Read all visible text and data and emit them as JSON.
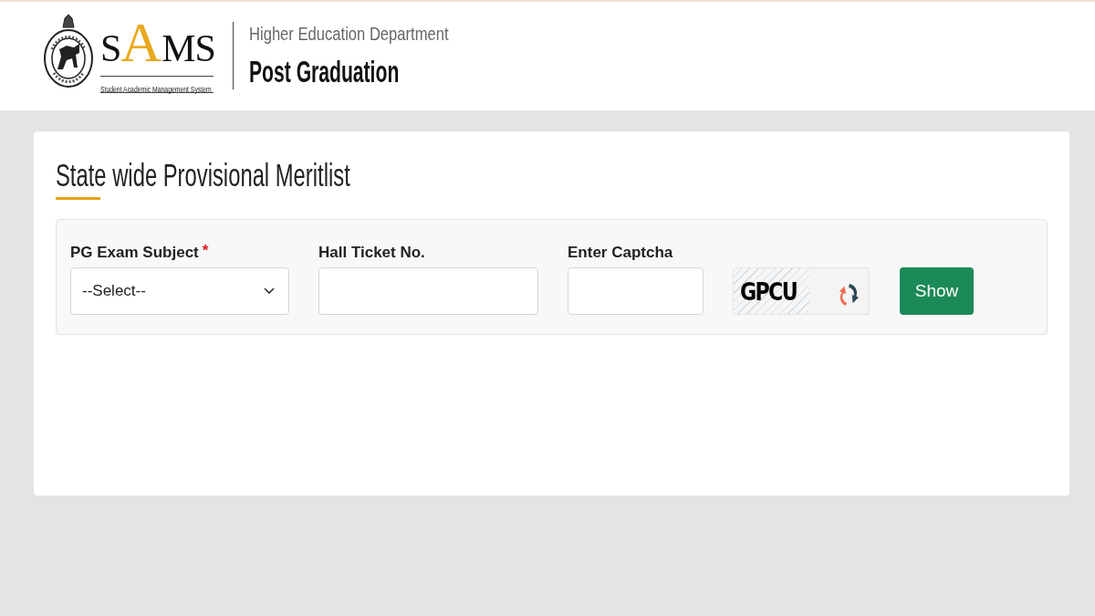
{
  "header": {
    "logo": {
      "wordmark": [
        {
          "text": "S",
          "accent": false
        },
        {
          "text": "A",
          "accent": true
        },
        {
          "text": "MS",
          "accent": false
        }
      ],
      "tagline": "Student Academic Management System"
    },
    "department": "Higher Education Department",
    "portal": "Post Graduation"
  },
  "page": {
    "title": "State wide Provisional Meritlist",
    "form": {
      "required_mark": "*",
      "fields": [
        {
          "kind": "select",
          "label": "PG Exam Subject",
          "required": true,
          "value": "--Select--"
        },
        {
          "kind": "text",
          "label": "Hall Ticket No.",
          "required": false
        },
        {
          "kind": "captcha",
          "label": "Enter Captcha",
          "required": false
        }
      ],
      "captcha": {
        "text": "GPCU"
      },
      "submit": "Show"
    }
  }
}
